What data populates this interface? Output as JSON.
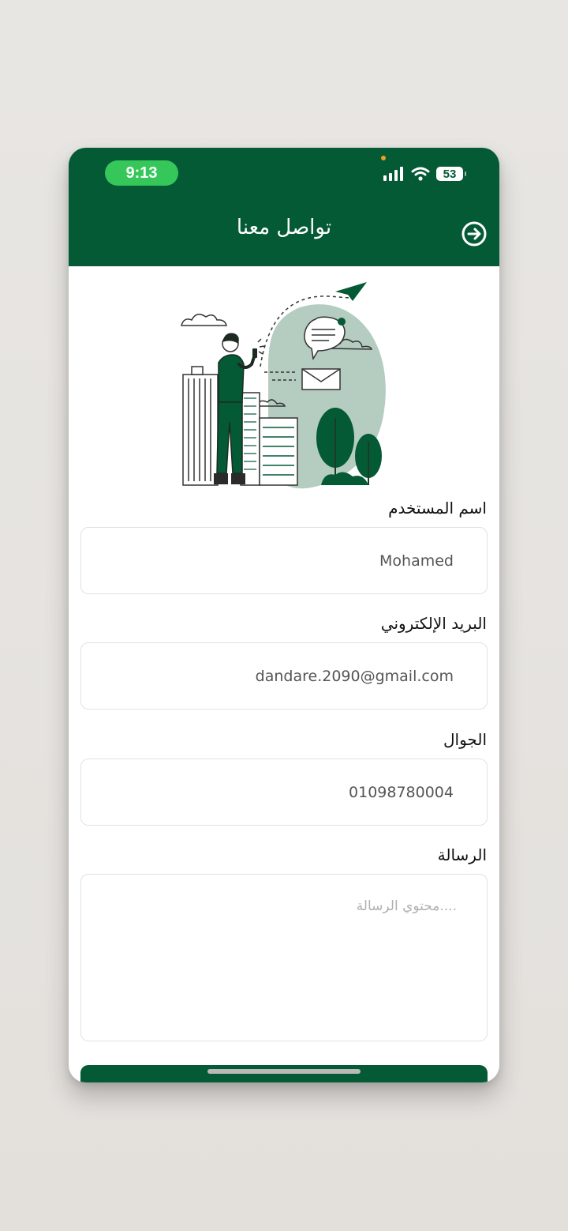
{
  "status_bar": {
    "time": "9:13",
    "battery": "53"
  },
  "header": {
    "title": "تواصل معنا",
    "back_icon": "arrow-right-circle-icon"
  },
  "illustration": {
    "icon": "contact-illustration"
  },
  "form": {
    "username": {
      "label": "اسم المستخدم",
      "value": "Mohamed"
    },
    "email": {
      "label": "البريد الإلكتروني",
      "value": "dandare.2090@gmail.com"
    },
    "phone": {
      "label": "الجوال",
      "value": "01098780004"
    },
    "message": {
      "label": "الرسالة",
      "placeholder": "....محتوي الرسالة"
    }
  },
  "colors": {
    "brand": "#045a35",
    "time_pill": "#35c759"
  }
}
